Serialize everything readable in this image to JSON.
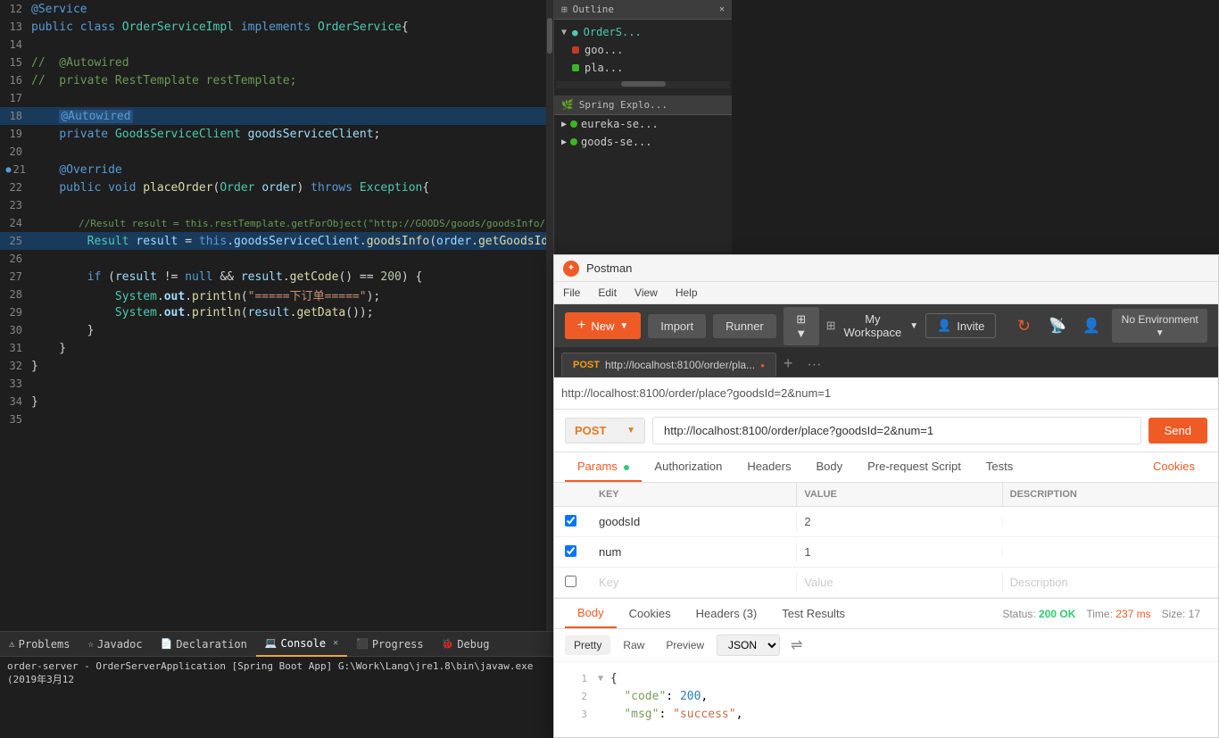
{
  "ide": {
    "code_lines": [
      {
        "num": "12",
        "content": "@Service",
        "highlight": false
      },
      {
        "num": "13",
        "content": "public class OrderServiceImpl implements OrderService{",
        "highlight": false
      },
      {
        "num": "14",
        "content": "",
        "highlight": false
      },
      {
        "num": "15",
        "content": "//  @Autowired",
        "highlight": false,
        "comment": true
      },
      {
        "num": "16",
        "content": "//  private RestTemplate restTemplate;",
        "highlight": false,
        "comment": true
      },
      {
        "num": "17",
        "content": "",
        "highlight": false
      },
      {
        "num": "18",
        "content": "    @Autowired",
        "highlight": true
      },
      {
        "num": "19",
        "content": "    private GoodsServiceClient goodsServiceClient;",
        "highlight": false
      },
      {
        "num": "20",
        "content": "",
        "highlight": false
      },
      {
        "num": "21",
        "content": "    @Override",
        "highlight": false
      },
      {
        "num": "22",
        "content": "    public void placeOrder(Order order) throws Exception{",
        "highlight": false
      },
      {
        "num": "23",
        "content": "",
        "highlight": false
      },
      {
        "num": "24",
        "content": "        //Result result = this.restTemplate.getForObject(\"http://GOODS/goods/goodsInfo/\" + order.getGoodsId(), Result.class);",
        "highlight": false,
        "comment": true
      },
      {
        "num": "25",
        "content": "        Result result = this.goodsServiceClient.goodsInfo(order.getGoodsId());",
        "highlight": true
      },
      {
        "num": "26",
        "content": "",
        "highlight": false
      },
      {
        "num": "27",
        "content": "        if (result != null && result.getCode() == 200) {",
        "highlight": false
      },
      {
        "num": "28",
        "content": "            System.out.println(\"=====下订单=====\");",
        "highlight": false
      },
      {
        "num": "29",
        "content": "            System.out.println(result.getData());",
        "highlight": false
      },
      {
        "num": "30",
        "content": "        }",
        "highlight": false
      },
      {
        "num": "31",
        "content": "    }",
        "highlight": false
      },
      {
        "num": "32",
        "content": "}",
        "highlight": false
      },
      {
        "num": "33",
        "content": "",
        "highlight": false
      },
      {
        "num": "34",
        "content": "}",
        "highlight": false
      },
      {
        "num": "35",
        "content": "",
        "highlight": false
      }
    ],
    "bottom_tabs": [
      {
        "label": "Problems",
        "icon": "⚠",
        "active": false
      },
      {
        "label": "Javadoc",
        "icon": "☆",
        "active": false
      },
      {
        "label": "Declaration",
        "icon": "📄",
        "active": false
      },
      {
        "label": "Console",
        "icon": "💻",
        "active": true
      },
      {
        "label": "Progress",
        "icon": "⬛",
        "active": false
      },
      {
        "label": "Debug",
        "icon": "🐞",
        "active": false
      }
    ],
    "console_text": "order-server - OrderServerApplication [Spring Boot App] G:\\Work\\Lang\\jre1.8\\bin\\javaw.exe (2019年3月12"
  },
  "outline": {
    "title": "Outline",
    "items": [
      {
        "label": "OrderS...",
        "type": "class"
      }
    ],
    "sub_items": [
      {
        "label": "goo...",
        "type": "field",
        "dot": "red"
      },
      {
        "label": "pla...",
        "type": "method",
        "dot": "green"
      }
    ],
    "spring_title": "Spring Explo...",
    "spring_items": [
      {
        "label": "eureka-se...",
        "dot": "green"
      },
      {
        "label": "goods-se...",
        "dot": "green"
      }
    ]
  },
  "postman": {
    "title": "Postman",
    "menu_items": [
      "File",
      "Edit",
      "View",
      "Help"
    ],
    "toolbar": {
      "new_label": "New",
      "import_label": "Import",
      "runner_label": "Runner",
      "workspace_label": "My Workspace",
      "invite_label": "Invite",
      "no_env_label": "No Environment"
    },
    "request_tab": {
      "method": "POST",
      "url_short": "http://localhost:8100/order/pla...",
      "dot": true
    },
    "url_bar": "http://localhost:8100/order/place?goodsId=2&num=1",
    "method": "POST",
    "url": "http://localhost:8100/order/place?goodsId=2&num=1",
    "send_label": "Send",
    "params_tabs": [
      {
        "label": "Params",
        "active": true,
        "green_dot": true
      },
      {
        "label": "Authorization",
        "active": false
      },
      {
        "label": "Headers",
        "active": false
      },
      {
        "label": "Body",
        "active": false
      },
      {
        "label": "Pre-request Script",
        "active": false
      },
      {
        "label": "Tests",
        "active": false
      },
      {
        "label": "Cookies",
        "active": false,
        "right": true
      }
    ],
    "params_headers": [
      "KEY",
      "VALUE",
      "DESCRIPTION"
    ],
    "params": [
      {
        "checked": true,
        "key": "goodsId",
        "value": "2",
        "desc": ""
      },
      {
        "checked": true,
        "key": "num",
        "value": "1",
        "desc": ""
      },
      {
        "checked": false,
        "key": "Key",
        "value": "Value",
        "desc": "Description",
        "empty": true
      }
    ],
    "response_tabs": [
      {
        "label": "Body",
        "active": true
      },
      {
        "label": "Cookies",
        "active": false
      },
      {
        "label": "Headers (3)",
        "active": false
      },
      {
        "label": "Test Results",
        "active": false
      }
    ],
    "response_status": "200 OK",
    "response_time": "237 ms",
    "response_size": "17",
    "format_tabs": [
      {
        "label": "Pretty",
        "active": true
      },
      {
        "label": "Raw",
        "active": false
      },
      {
        "label": "Preview",
        "active": false
      }
    ],
    "format_select": "JSON",
    "json_lines": [
      {
        "num": "1",
        "content": "{",
        "type": "bracket",
        "fold": true
      },
      {
        "num": "2",
        "content": "\"code\": 200,",
        "key": "code",
        "value": "200"
      },
      {
        "num": "3",
        "content": "\"msg\": \"success\",",
        "key": "msg",
        "value": "\"success\""
      }
    ]
  }
}
